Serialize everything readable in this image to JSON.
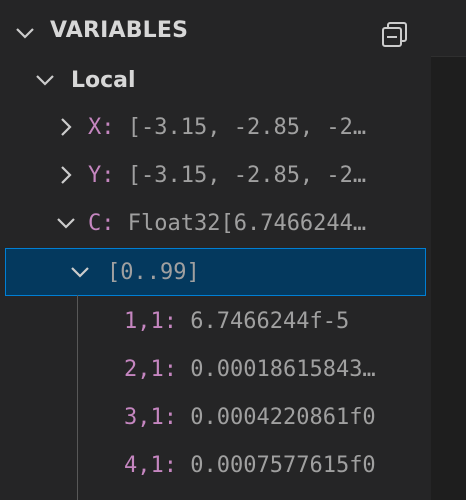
{
  "panel": {
    "title": "VARIABLES"
  },
  "scope": {
    "label": "Local"
  },
  "variables": [
    {
      "name": "X",
      "sep": ": ",
      "value": "[-3.15, -2.85, -2…"
    },
    {
      "name": "Y",
      "sep": ": ",
      "value": "[-3.15, -2.85, -2…"
    },
    {
      "name": "C",
      "sep": ": ",
      "value": "Float32[6.7466244…"
    }
  ],
  "range": {
    "label": "[0..99]"
  },
  "elements": [
    {
      "index": "1,1",
      "sep": ": ",
      "value": "6.7466244f-5"
    },
    {
      "index": "2,1",
      "sep": ": ",
      "value": "0.00018615843…"
    },
    {
      "index": "3,1",
      "sep": ": ",
      "value": "0.0004220861f0"
    },
    {
      "index": "4,1",
      "sep": ": ",
      "value": "0.0007577615f0"
    }
  ],
  "icons": {
    "expanded": "chevron-down-icon",
    "collapsed": "chevron-right-icon",
    "collapse_all": "collapse-all-icon"
  },
  "colors": {
    "background": "#252526",
    "selection": "#04395e",
    "selection_border": "#007fd4",
    "name": "#c586c0",
    "value": "#a0a0a0"
  }
}
